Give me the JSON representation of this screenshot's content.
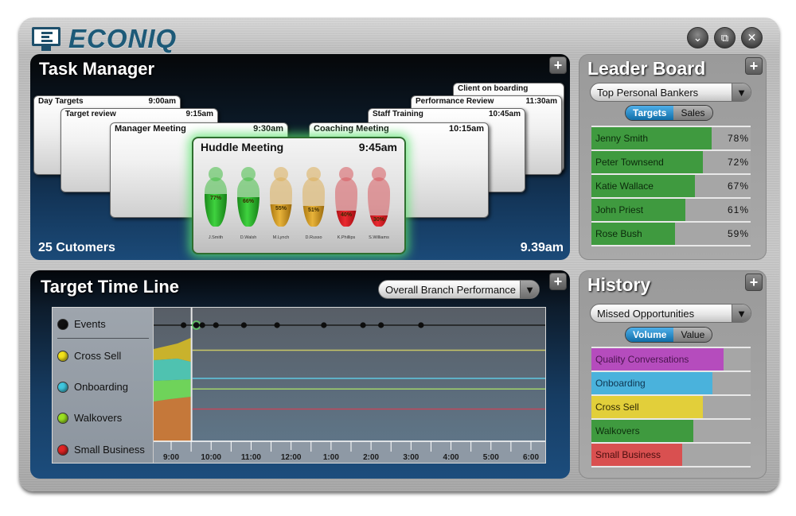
{
  "app": {
    "logo_text": "ECONIQ",
    "logo_icon": "monitor-e-icon",
    "window_controls": [
      {
        "name": "minimize",
        "icon": "chevron-down-icon",
        "glyph": "⌄"
      },
      {
        "name": "restore",
        "icon": "restore-window-icon",
        "glyph": "⧉"
      },
      {
        "name": "close",
        "icon": "close-icon",
        "glyph": "✕"
      }
    ]
  },
  "task_manager": {
    "title": "Task Manager",
    "add_glyph": "+",
    "tasks": [
      {
        "title": "Day Targets",
        "time": "9:00am"
      },
      {
        "title": "Target review",
        "time": "9:15am"
      },
      {
        "title": "Manager Meeting",
        "time": "9:30am"
      },
      {
        "title": "Client on boarding",
        "time": ""
      },
      {
        "title": "Performance Review",
        "time": "11:30am"
      },
      {
        "title": "Staff Training",
        "time": "10:45am"
      },
      {
        "title": "Coaching Meeting",
        "time": "10:15am"
      }
    ],
    "active_task": {
      "title": "Huddle Meeting",
      "time": "9:45am",
      "people": [
        {
          "name": "J.Smith",
          "percent": "77%",
          "fill": 0.66,
          "status": "green"
        },
        {
          "name": "D.Walsh",
          "percent": "66%",
          "fill": 0.6,
          "status": "green"
        },
        {
          "name": "M.Lynch",
          "percent": "55%",
          "fill": 0.45,
          "status": "amber"
        },
        {
          "name": "D.Russo",
          "percent": "51%",
          "fill": 0.42,
          "status": "amber"
        },
        {
          "name": "K.Phillips",
          "percent": "40%",
          "fill": 0.32,
          "status": "red"
        },
        {
          "name": "S.Williams",
          "percent": "30%",
          "fill": 0.22,
          "status": "red"
        }
      ]
    },
    "customers_label": "25 Cutomers",
    "current_time": "9.39am"
  },
  "leader_board": {
    "title": "Leader Board",
    "add_glyph": "+",
    "dropdown_value": "Top Personal Bankers",
    "dropdown_arrow": "▼",
    "toggle": {
      "active": "Targets",
      "inactive": "Sales"
    },
    "rows": [
      {
        "name": "Jenny Smith",
        "value": "78%",
        "fraction": 0.78
      },
      {
        "name": "Peter Townsend",
        "value": "72%",
        "fraction": 0.72
      },
      {
        "name": "Katie Wallace",
        "value": "67%",
        "fraction": 0.67
      },
      {
        "name": "John Priest",
        "value": "61%",
        "fraction": 0.61
      },
      {
        "name": "Rose Bush",
        "value": "59%",
        "fraction": 0.54
      }
    ],
    "bar_color": "#3f9a3f"
  },
  "timeline": {
    "title": "Target Time Line",
    "add_glyph": "+",
    "dropdown_value": "Overall Branch Performance",
    "dropdown_arrow": "▼",
    "legend": [
      {
        "label": "Events",
        "color": "#111111"
      },
      {
        "label": "Cross Sell",
        "color": "#f2e21a"
      },
      {
        "label": "Onboarding",
        "color": "#3fc7df"
      },
      {
        "label": "Walkovers",
        "color": "#9be021"
      },
      {
        "label": "Small Business",
        "color": "#e02424"
      }
    ],
    "x_ticks": [
      "9:00",
      "10:00",
      "11:00",
      "12:00",
      "1:00",
      "2:00",
      "3:00",
      "4:00",
      "5:00",
      "6:00"
    ],
    "current_time_hours": 9.65,
    "event_times_hours": [
      9.55,
      9.65,
      9.78,
      10.12,
      10.82,
      11.65,
      12.82,
      13.8,
      14.25,
      15.25
    ],
    "target_lines": [
      {
        "series": "Cross Sell",
        "color": "#c9c667",
        "level": 0.83
      },
      {
        "series": "Onboarding",
        "color": "#5ec9e2",
        "level": 0.62
      },
      {
        "series": "Walkovers",
        "color": "#a2d36b",
        "level": 0.54
      },
      {
        "series": "Small Business",
        "color": "#c2475a",
        "level": 0.39
      }
    ]
  },
  "history": {
    "title": "History",
    "add_glyph": "+",
    "dropdown_value": "Missed Opportunities",
    "dropdown_arrow": "▼",
    "toggle": {
      "active": "Volume",
      "inactive": "Value"
    },
    "rows": [
      {
        "name": "Quality Conversations",
        "fraction": 0.83,
        "color": "#b54cbd",
        "text_color": "#4a154f"
      },
      {
        "name": "Onboarding",
        "fraction": 0.76,
        "color": "#4ab2dc",
        "text_color": "#0f3550"
      },
      {
        "name": "Cross Sell",
        "fraction": 0.7,
        "color": "#e2cf3a",
        "text_color": "#2f2a05"
      },
      {
        "name": "Walkovers",
        "fraction": 0.64,
        "color": "#3f9a3f",
        "text_color": "#0d2e0d"
      },
      {
        "name": "Small Business",
        "fraction": 0.57,
        "color": "#d95050",
        "text_color": "#4a0e0e"
      }
    ]
  }
}
